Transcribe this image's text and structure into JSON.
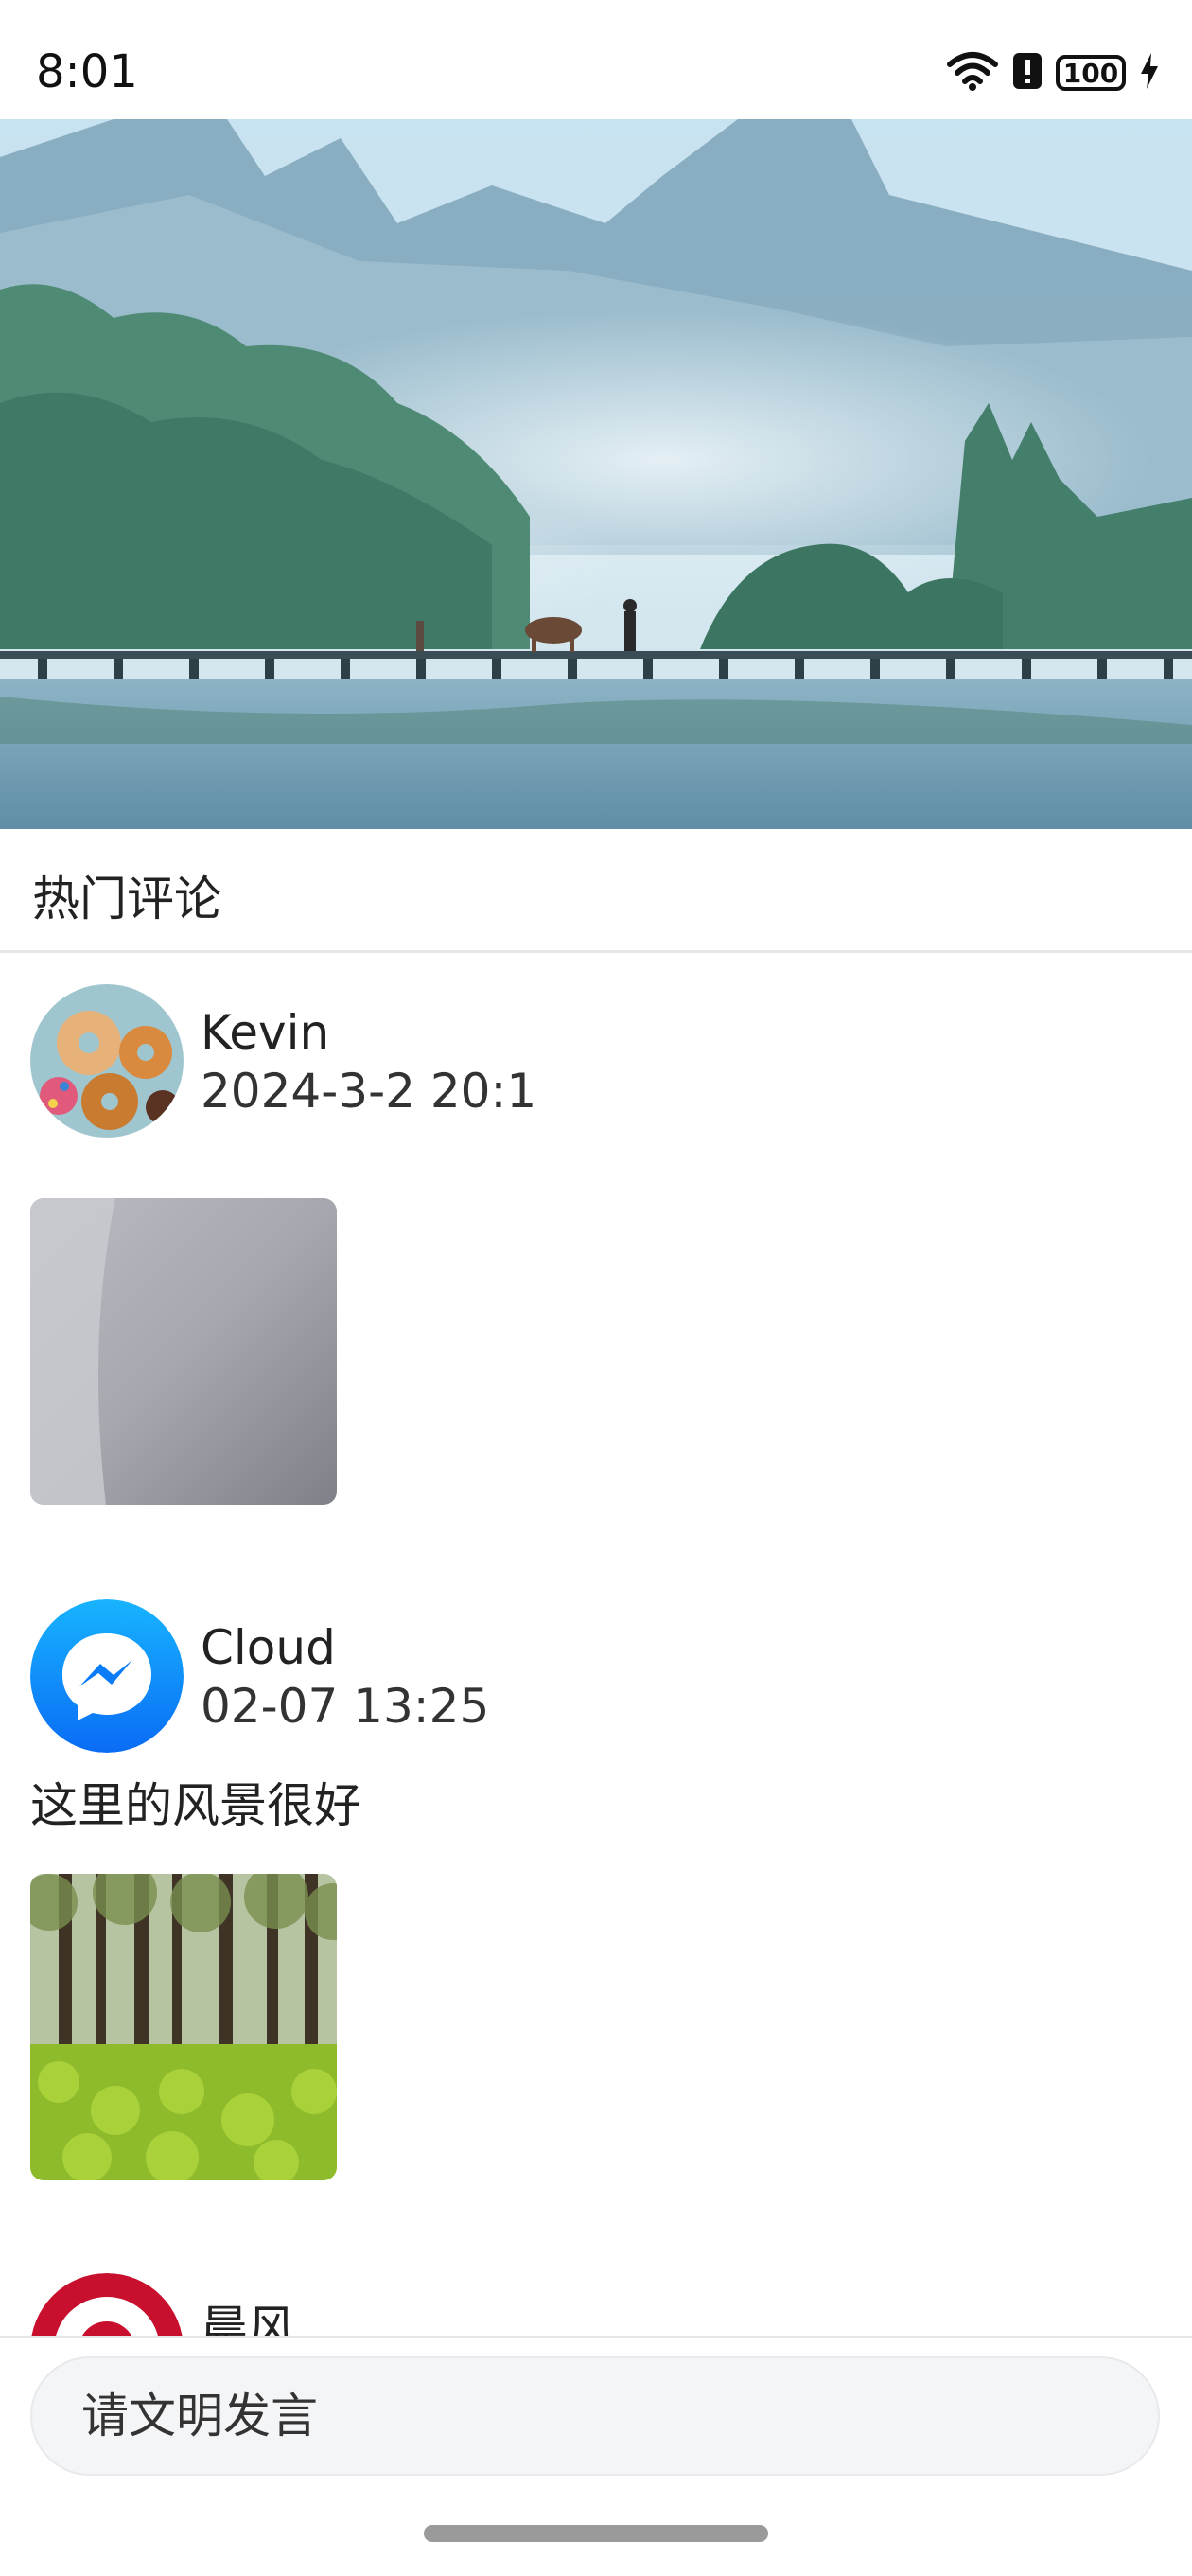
{
  "status_bar": {
    "time": "8:01",
    "battery": "100",
    "icons": [
      "wifi-icon",
      "alert-icon",
      "battery-icon",
      "charging-icon"
    ]
  },
  "section": {
    "title": "热门评论"
  },
  "comments": [
    {
      "name": "Kevin",
      "time": "2024-3-2 20:1",
      "text": "",
      "avatar_icon": "donuts-avatar",
      "photo": "gray-surface-photo"
    },
    {
      "name": "Cloud",
      "time": "02-07 13:25",
      "text": "这里的风景很好",
      "avatar_icon": "messenger-avatar",
      "photo": "green-field-photo"
    },
    {
      "name": "晨风",
      "avatar_icon": "target-avatar"
    }
  ],
  "input": {
    "placeholder": "请文明发言"
  },
  "colors": {
    "divider": "#e6e6e6",
    "input_bg": "#f4f5f7",
    "messenger_blue": "#1a8cff",
    "target_red": "#c8102e"
  }
}
